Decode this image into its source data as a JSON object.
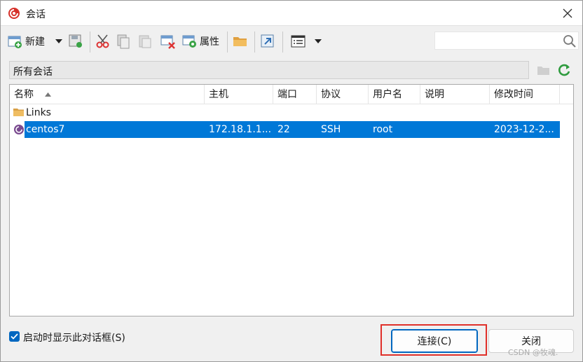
{
  "window": {
    "title": "会话",
    "close_label": "✕"
  },
  "toolbar": {
    "new_label": "新建",
    "properties_label": "属性",
    "search_placeholder": ""
  },
  "pathbar": {
    "label": "所有会话"
  },
  "list": {
    "columns": [
      "名称",
      "主机",
      "端口",
      "协议",
      "用户名",
      "说明",
      "修改时间"
    ],
    "rows": [
      {
        "name": "Links",
        "host": "",
        "port": "",
        "protocol": "",
        "user": "",
        "desc": "",
        "modified": "",
        "icon": "folder-icon"
      },
      {
        "name": "centos7",
        "host": "172.18.1.1...",
        "port": "22",
        "protocol": "SSH",
        "user": "root",
        "desc": "",
        "modified": "2023-12-2...",
        "icon": "session-icon"
      }
    ]
  },
  "footer": {
    "show_on_startup_label": "启动时显示此对话框(S)",
    "connect_label": "连接(C)",
    "close_label": "关闭",
    "watermark": "CSDN @牧魂."
  },
  "colors": {
    "selection": "#0078d7",
    "highlight_frame": "#e0302a",
    "accent": "#0067c0"
  }
}
